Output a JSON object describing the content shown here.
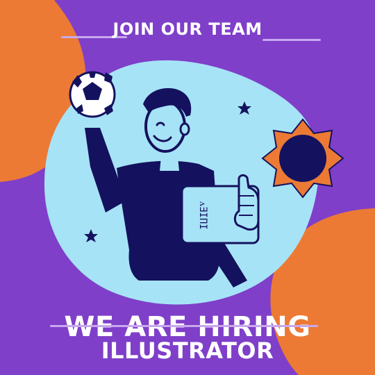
{
  "header": {
    "title": "JOIN OUR TEAM"
  },
  "headline": {
    "text": "WE ARE HIRING"
  },
  "subheadline": {
    "text": "ILLUSTRATOR"
  },
  "colors": {
    "background": "#7f3fc9",
    "accent_orange": "#ec7a35",
    "blob": "#a7e3f6",
    "navy": "#14125e",
    "text": "#ffffff",
    "line": "#c9a8ef"
  },
  "illustration": {
    "icons": [
      "soccer-ball-icon",
      "star-icon",
      "burst-badge-icon"
    ]
  }
}
